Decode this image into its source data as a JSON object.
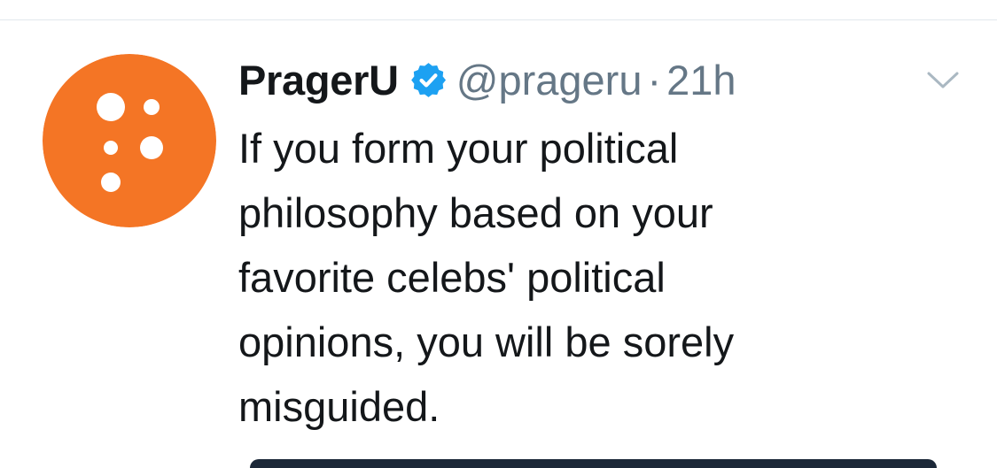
{
  "tweet": {
    "display_name": "PragerU",
    "handle": "@prageru",
    "separator": "·",
    "timestamp": "21h",
    "verified": true,
    "text": "If you form your political\nphilosophy based on your\nfavorite celebs' political\nopinions, you will be sorely\nmisguided."
  },
  "icons": {
    "avatar": "prageru-logo-avatar",
    "verified": "verified-badge-icon",
    "menu": "chevron-down-icon"
  },
  "colors": {
    "avatar_bg": "#F47525",
    "verified_blue": "#1DA1F2",
    "text": "#14171A",
    "secondary_text": "#657786",
    "divider": "#E1E8ED"
  }
}
